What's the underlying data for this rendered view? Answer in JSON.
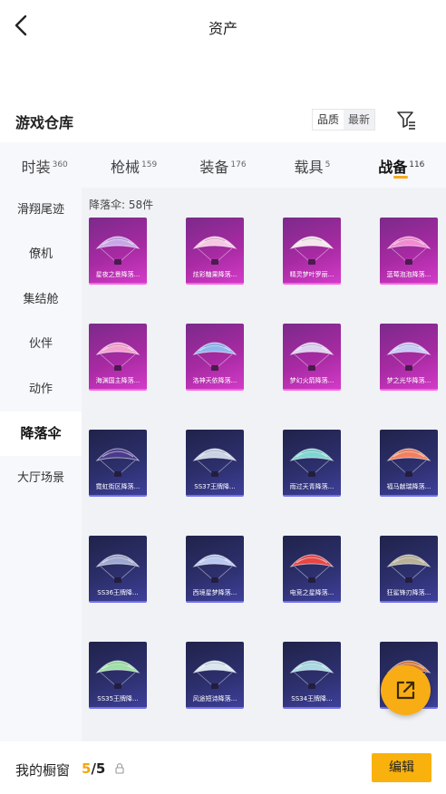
{
  "header": {
    "title": "资产"
  },
  "warehouse": {
    "title": "游戏仓库",
    "sort": [
      "品质",
      "最新"
    ]
  },
  "tabs": [
    {
      "label": "时装",
      "count": "360"
    },
    {
      "label": "枪械",
      "count": "159"
    },
    {
      "label": "装备",
      "count": "176"
    },
    {
      "label": "载具",
      "count": "5"
    },
    {
      "label": "战备",
      "count": "116"
    }
  ],
  "sidebar": [
    "滑翔尾迹",
    "僚机",
    "集结舱",
    "伙伴",
    "动作",
    "降落伞",
    "大厅场景"
  ],
  "main": {
    "count_label": "降落伞: 58件"
  },
  "items": [
    {
      "label": "星夜之景降落...",
      "rarity": "purple",
      "color": "#c9a6e8"
    },
    {
      "label": "炫彩糖果降落...",
      "rarity": "purple",
      "color": "#f5c7e2"
    },
    {
      "label": "精灵梦叶罗丽...",
      "rarity": "purple",
      "color": "#f4e6ea"
    },
    {
      "label": "蓝莓泡泡降落...",
      "rarity": "purple",
      "color": "#f28bd0"
    },
    {
      "label": "海渊国主降落...",
      "rarity": "purple",
      "color": "#f3a1cf"
    },
    {
      "label": "洛神天依降落...",
      "rarity": "purple",
      "color": "#8fb7ee"
    },
    {
      "label": "梦幻火箭降落...",
      "rarity": "purple",
      "color": "#ddd0f0"
    },
    {
      "label": "梦之光华降落...",
      "rarity": "purple",
      "color": "#c7c9f6"
    },
    {
      "label": "霓虹街区降落...",
      "rarity": "blue",
      "color": "#4a3a8c"
    },
    {
      "label": "SS37王牌降...",
      "rarity": "blue",
      "color": "#c9d3e4"
    },
    {
      "label": "雨过天青降落...",
      "rarity": "blue",
      "color": "#7fd6d2"
    },
    {
      "label": "福马献瑞降落...",
      "rarity": "blue",
      "color": "#f28060"
    },
    {
      "label": "SS36王牌降...",
      "rarity": "blue",
      "color": "#9ea7cf"
    },
    {
      "label": "西境星梦降落...",
      "rarity": "blue",
      "color": "#b8c7ee"
    },
    {
      "label": "电竞之星降落...",
      "rarity": "blue",
      "color": "#e94545"
    },
    {
      "label": "狂鲨锋刃降落...",
      "rarity": "blue",
      "color": "#b8b197"
    },
    {
      "label": "SS35王牌降...",
      "rarity": "blue",
      "color": "#9fe0a6"
    },
    {
      "label": "风途短诗降落...",
      "rarity": "blue",
      "color": "#d8e6ef"
    },
    {
      "label": "SS34王牌降...",
      "rarity": "blue",
      "color": "#a8d9e4"
    },
    {
      "label": "",
      "rarity": "blue",
      "color": "#d97b3a"
    }
  ],
  "bottom": {
    "showcase_label": "我的橱窗",
    "count_current": "5",
    "count_total": "/5",
    "edit_label": "编辑"
  },
  "colors": {
    "accent": "#f8b10d",
    "purple_rarity": "#a72aa2",
    "blue_rarity": "#2c2f6b"
  },
  "icons": [
    "back-arrow-icon",
    "filter-icon",
    "lock-icon",
    "share-icon"
  ]
}
